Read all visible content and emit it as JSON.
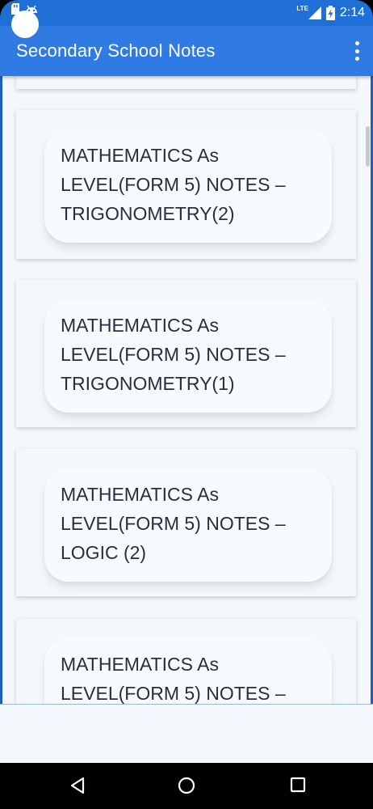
{
  "status_bar": {
    "network": "LTE",
    "time": "2:14",
    "icons": [
      "sd-card-icon",
      "android-icon",
      "signal-icon",
      "battery-charging-icon"
    ]
  },
  "app_bar": {
    "title": "Secondary School Notes",
    "menu_icon": "more-vert-icon"
  },
  "notes": [
    {
      "title": ""
    },
    {
      "title": "MATHEMATICS As LEVEL(FORM 5) NOTES – TRIGONOMETRY(2)"
    },
    {
      "title": "MATHEMATICS As LEVEL(FORM 5) NOTES – TRIGONOMETRY(1)"
    },
    {
      "title": "MATHEMATICS As LEVEL(FORM 5) NOTES – LOGIC (2)"
    },
    {
      "title": "MATHEMATICS As LEVEL(FORM 5) NOTES –"
    }
  ],
  "nav_bar": {
    "back_icon": "back-triangle-icon",
    "home_icon": "home-circle-icon",
    "recent_icon": "recent-square-icon"
  },
  "colors": {
    "status_bar": "#1f6fd6",
    "app_bar": "#2f7be3",
    "card_bg": "#f2f8fc",
    "text": "#2a2d40"
  }
}
